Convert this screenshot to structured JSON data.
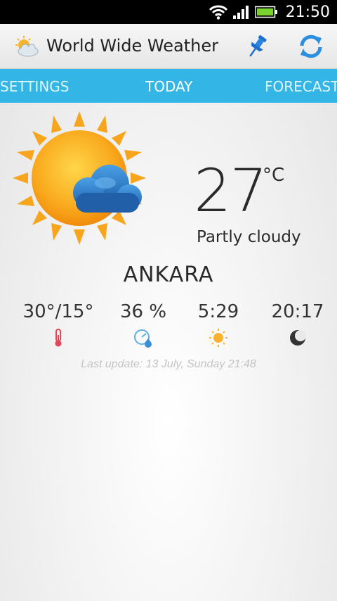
{
  "status_bar": {
    "time": "21:50"
  },
  "app": {
    "title": "World Wide Weather"
  },
  "tabs": [
    {
      "label": "SETTINGS"
    },
    {
      "label": "TODAY"
    },
    {
      "label": "FORECAST"
    }
  ],
  "current": {
    "temperature": "27",
    "unit": "°C",
    "condition": "Partly cloudy",
    "city": "ANKARA",
    "icon": "partly-cloudy-sun-icon"
  },
  "stats": {
    "high_low": "30°/15°",
    "humidity": "36 %",
    "sunrise": "5:29",
    "sunset": "20:17"
  },
  "last_update": "Last update: 13 July, Sunday 21:48",
  "colors": {
    "tab_bar": "#33b5e5",
    "status_bar": "#000000",
    "sun": "#f7a51c",
    "cloud": "#2f7dc9",
    "thermometer": "#e0475a",
    "sunrise_icon": "#f8b230"
  }
}
